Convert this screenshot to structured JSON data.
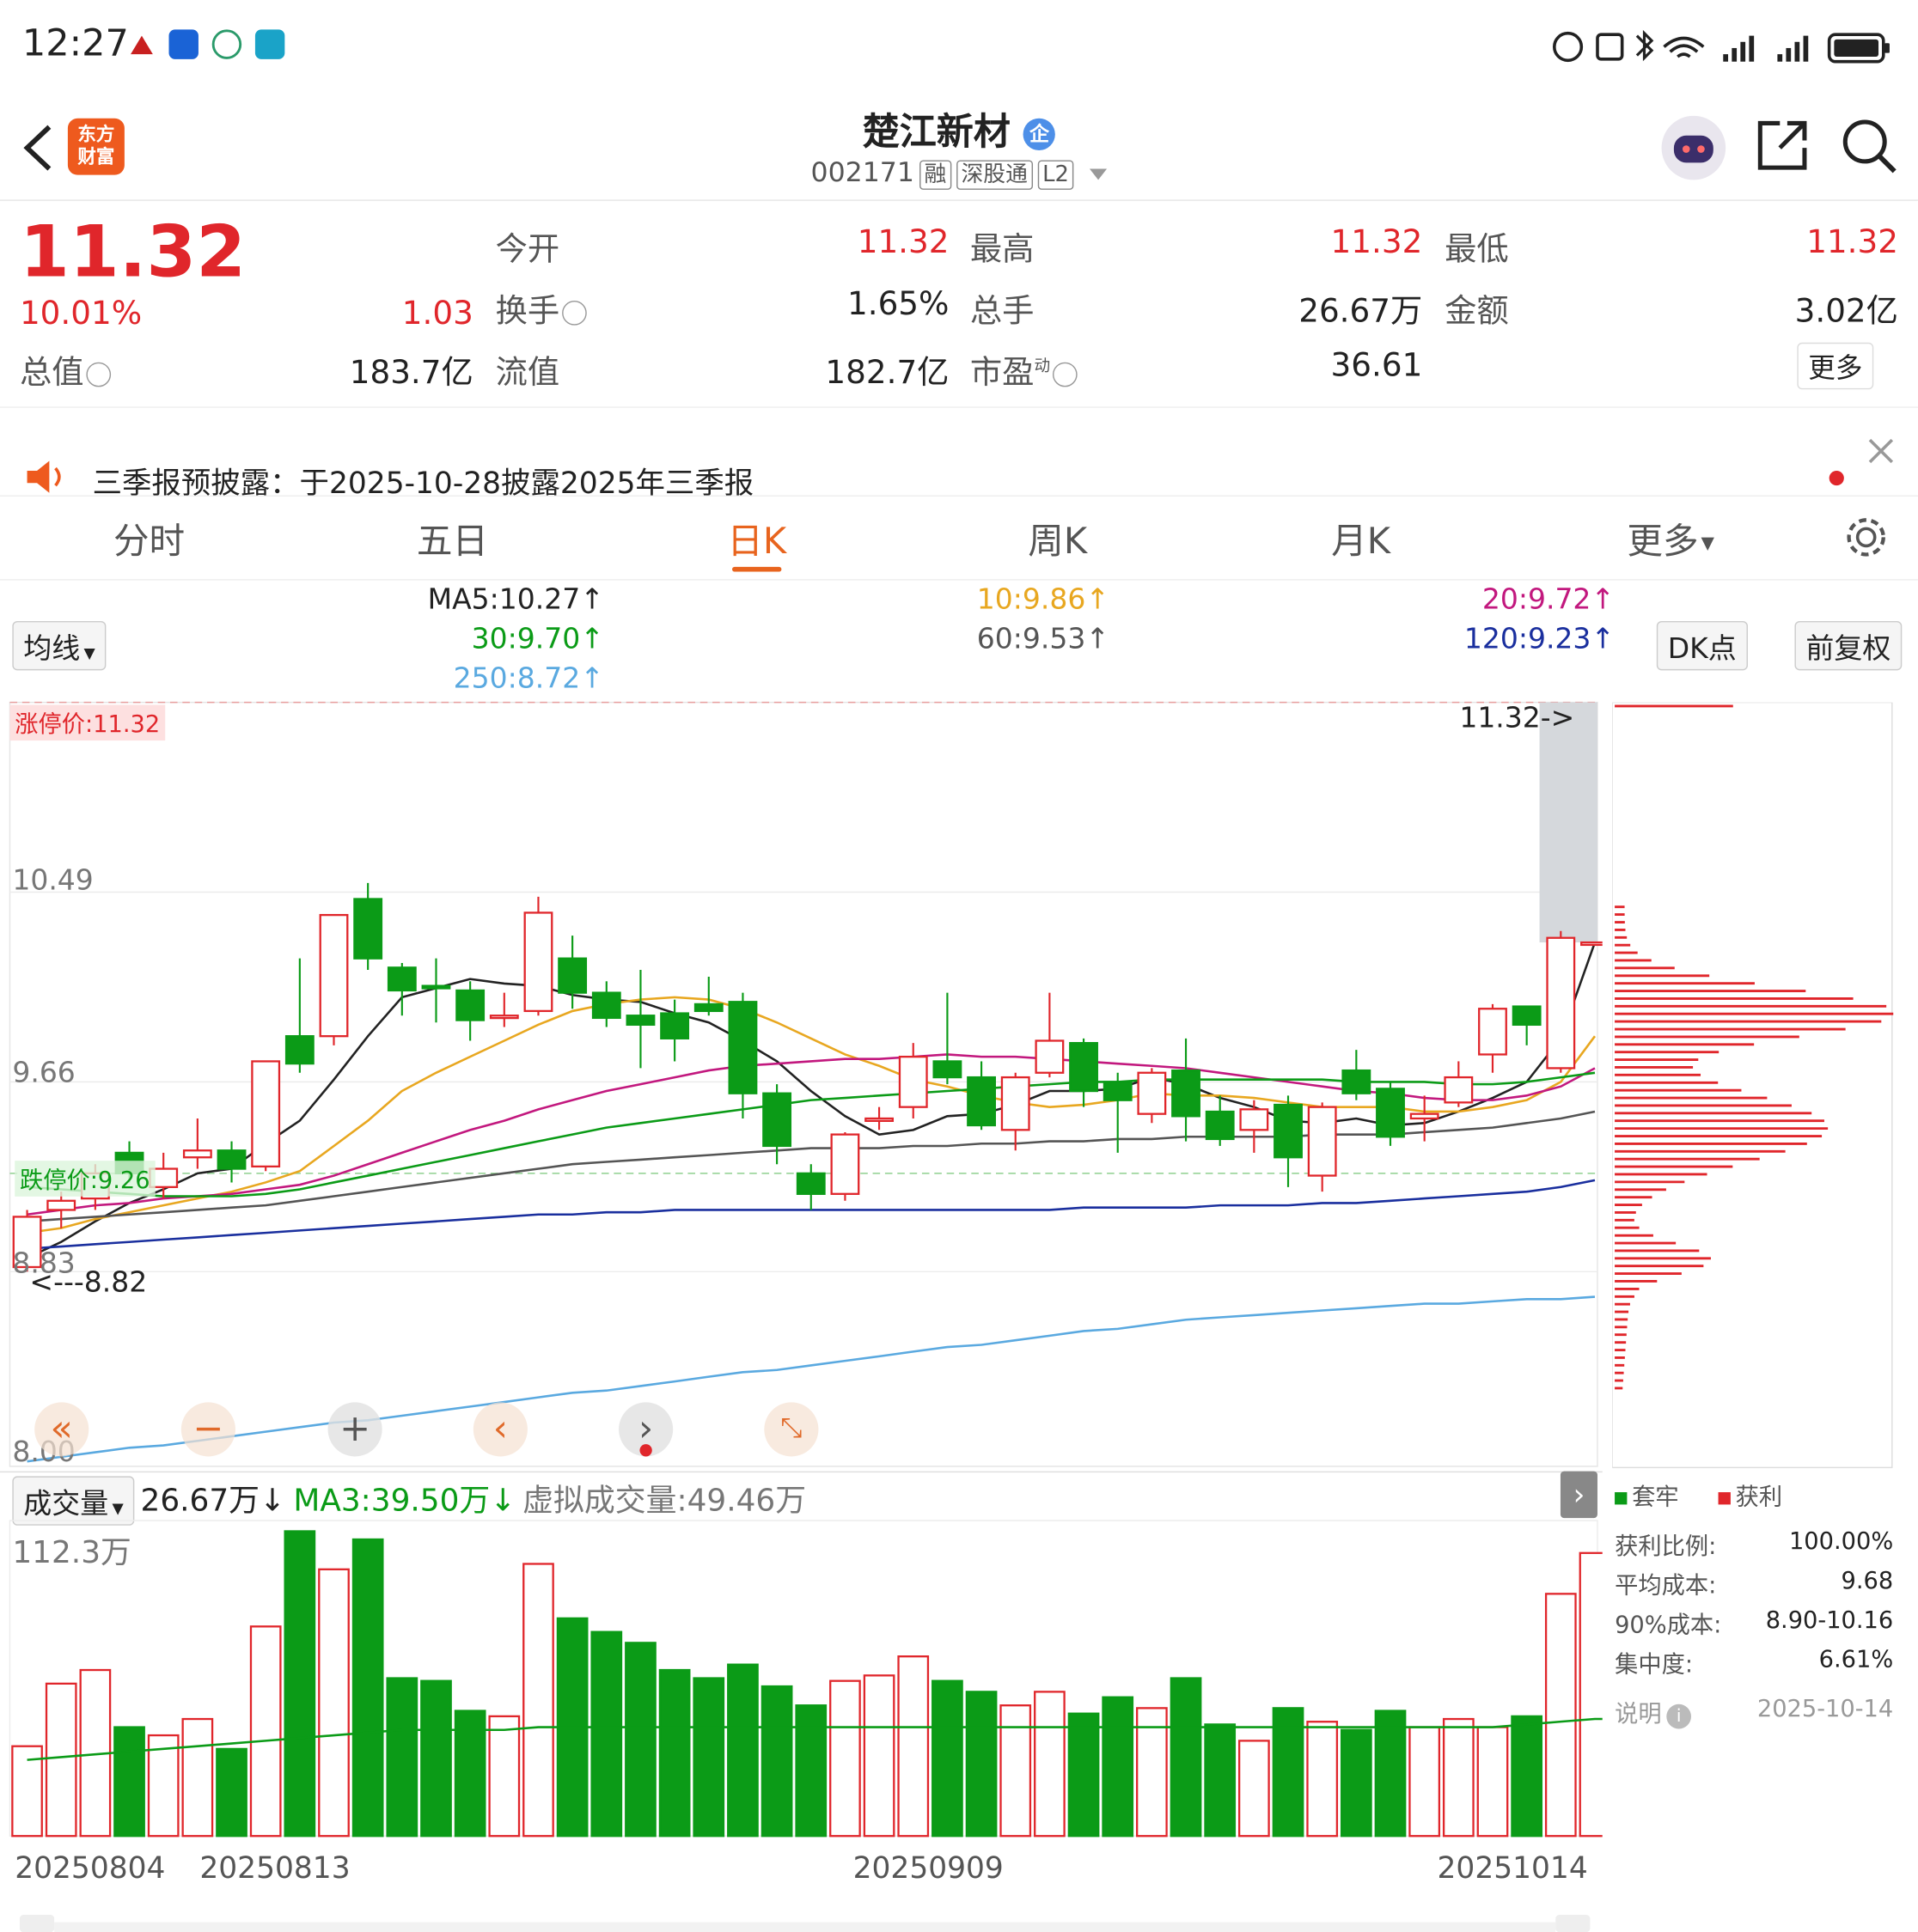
{
  "status_bar": {
    "time": "12:27"
  },
  "header": {
    "stock_name": "楚江新材",
    "badge": "企",
    "code": "002171",
    "tags": [
      "融",
      "深股通",
      "L2"
    ]
  },
  "quote": {
    "price": "11.32",
    "change_pct": "10.01%",
    "change": "1.03",
    "fields": [
      {
        "label": "今开",
        "value": "11.32",
        "red": true
      },
      {
        "label": "最高",
        "value": "11.32",
        "red": true
      },
      {
        "label": "最低",
        "value": "11.32",
        "red": true
      },
      {
        "label": "换手",
        "value": "1.65%",
        "red": false
      },
      {
        "label": "总手",
        "value": "26.67万",
        "red": false
      },
      {
        "label": "金额",
        "value": "3.02亿",
        "red": false
      },
      {
        "label": "总值",
        "value": "183.7亿",
        "red": false
      },
      {
        "label": "流值",
        "value": "182.7亿",
        "red": false
      },
      {
        "label": "市盈",
        "value": "36.61",
        "red": false
      }
    ],
    "pe_superscript": "动",
    "more_button": "更多"
  },
  "notice": {
    "text": "三季报预披露：于2025-10-28披露2025年三季报"
  },
  "tabs": [
    "分时",
    "五日",
    "日K",
    "周K",
    "月K",
    "更多"
  ],
  "active_tab": "日K",
  "ma_bar": {
    "selector": "均线",
    "dk_button": "DK点",
    "rights_button": "前复权",
    "items": [
      {
        "text": "MA5:10.27↑",
        "color": "#222222"
      },
      {
        "text": "10:9.86↑",
        "color": "#e8a720"
      },
      {
        "text": "20:9.72↑",
        "color": "#c2187e"
      },
      {
        "text": "30:9.70↑",
        "color": "#0b9b17"
      },
      {
        "text": "60:9.53↑",
        "color": "#555555"
      },
      {
        "text": "120:9.23↑",
        "color": "#1a2f9e"
      },
      {
        "text": "250:8.72↑",
        "color": "#5aa9e0"
      }
    ]
  },
  "main_chart": {
    "limit_up_label": "涨停价:11.32",
    "limit_down_label": "跌停价:9.26",
    "price_ticks": [
      "10.49",
      "9.66",
      "8.83",
      "8.00"
    ],
    "current_marker": "11.32->",
    "low_marker": "<---8.82"
  },
  "chart_data": {
    "type": "candlestick",
    "dates_shown": [
      "20250804",
      "20250813",
      "20250909",
      "20251014"
    ],
    "ylim": [
      8.0,
      11.32
    ],
    "candles": [
      {
        "o": 8.85,
        "c": 9.07,
        "h": 9.1,
        "l": 8.83
      },
      {
        "o": 9.1,
        "c": 9.14,
        "h": 9.18,
        "l": 9.02
      },
      {
        "o": 9.15,
        "c": 9.26,
        "h": 9.3,
        "l": 9.1
      },
      {
        "o": 9.35,
        "c": 9.26,
        "h": 9.4,
        "l": 9.22
      },
      {
        "o": 9.2,
        "c": 9.28,
        "h": 9.35,
        "l": 9.15
      },
      {
        "o": 9.33,
        "c": 9.36,
        "h": 9.5,
        "l": 9.28
      },
      {
        "o": 9.36,
        "c": 9.28,
        "h": 9.4,
        "l": 9.22
      },
      {
        "o": 9.29,
        "c": 9.75,
        "h": 9.75,
        "l": 9.27
      },
      {
        "o": 9.86,
        "c": 9.74,
        "h": 10.2,
        "l": 9.7
      },
      {
        "o": 9.86,
        "c": 10.39,
        "h": 10.39,
        "l": 9.82
      },
      {
        "o": 10.46,
        "c": 10.2,
        "h": 10.53,
        "l": 10.15
      },
      {
        "o": 10.16,
        "c": 10.06,
        "h": 10.18,
        "l": 9.95
      },
      {
        "o": 10.08,
        "c": 10.07,
        "h": 10.2,
        "l": 9.92
      },
      {
        "o": 10.06,
        "c": 9.93,
        "h": 10.1,
        "l": 9.84
      },
      {
        "o": 9.95,
        "c": 9.95,
        "h": 10.05,
        "l": 9.9
      },
      {
        "o": 9.97,
        "c": 10.4,
        "h": 10.47,
        "l": 9.95
      },
      {
        "o": 10.2,
        "c": 10.05,
        "h": 10.3,
        "l": 9.98
      },
      {
        "o": 10.05,
        "c": 9.94,
        "h": 10.1,
        "l": 9.9
      },
      {
        "o": 9.95,
        "c": 9.91,
        "h": 10.15,
        "l": 9.72
      },
      {
        "o": 9.96,
        "c": 9.85,
        "h": 10.02,
        "l": 9.75
      },
      {
        "o": 10.0,
        "c": 9.97,
        "h": 10.12,
        "l": 9.95
      },
      {
        "o": 10.01,
        "c": 9.61,
        "h": 10.05,
        "l": 9.5
      },
      {
        "o": 9.61,
        "c": 9.38,
        "h": 9.65,
        "l": 9.3
      },
      {
        "o": 9.26,
        "c": 9.17,
        "h": 9.3,
        "l": 9.1
      },
      {
        "o": 9.17,
        "c": 9.43,
        "h": 9.44,
        "l": 9.14
      },
      {
        "o": 9.5,
        "c": 9.5,
        "h": 9.55,
        "l": 9.45
      },
      {
        "o": 9.55,
        "c": 9.77,
        "h": 9.83,
        "l": 9.5
      },
      {
        "o": 9.75,
        "c": 9.68,
        "h": 10.05,
        "l": 9.65
      },
      {
        "o": 9.68,
        "c": 9.47,
        "h": 9.75,
        "l": 9.45
      },
      {
        "o": 9.45,
        "c": 9.68,
        "h": 9.7,
        "l": 9.36
      },
      {
        "o": 9.7,
        "c": 9.84,
        "h": 10.05,
        "l": 9.68
      },
      {
        "o": 9.83,
        "c": 9.62,
        "h": 9.85,
        "l": 9.55
      },
      {
        "o": 9.66,
        "c": 9.58,
        "h": 9.7,
        "l": 9.35
      },
      {
        "o": 9.52,
        "c": 9.7,
        "h": 9.72,
        "l": 9.48
      },
      {
        "o": 9.71,
        "c": 9.51,
        "h": 9.85,
        "l": 9.4
      },
      {
        "o": 9.53,
        "c": 9.41,
        "h": 9.6,
        "l": 9.38
      },
      {
        "o": 9.45,
        "c": 9.54,
        "h": 9.58,
        "l": 9.35
      },
      {
        "o": 9.56,
        "c": 9.33,
        "h": 9.6,
        "l": 9.2
      },
      {
        "o": 9.25,
        "c": 9.55,
        "h": 9.57,
        "l": 9.18
      },
      {
        "o": 9.71,
        "c": 9.61,
        "h": 9.8,
        "l": 9.58
      },
      {
        "o": 9.63,
        "c": 9.42,
        "h": 9.66,
        "l": 9.38
      },
      {
        "o": 9.5,
        "c": 9.52,
        "h": 9.6,
        "l": 9.4
      },
      {
        "o": 9.57,
        "c": 9.68,
        "h": 9.75,
        "l": 9.55
      },
      {
        "o": 9.78,
        "c": 9.98,
        "h": 10.0,
        "l": 9.7
      },
      {
        "o": 9.99,
        "c": 9.91,
        "h": 9.99,
        "l": 9.82
      },
      {
        "o": 9.72,
        "c": 10.29,
        "h": 10.32,
        "l": 9.7
      },
      {
        "o": 10.27,
        "c": 10.27,
        "h": 10.27,
        "l": 10.27
      }
    ],
    "ma_lines": [
      {
        "name": "MA5",
        "values": [
          8.89,
          8.96,
          9.05,
          9.13,
          9.19,
          9.26,
          9.28,
          9.39,
          9.49,
          9.67,
          9.86,
          10.03,
          10.07,
          10.11,
          10.09,
          10.08,
          10.04,
          10.02,
          10.01,
          9.96,
          9.92,
          9.84,
          9.75,
          9.62,
          9.51,
          9.43,
          9.45,
          9.51,
          9.52,
          9.56,
          9.62,
          9.62,
          9.63,
          9.68,
          9.65,
          9.59,
          9.55,
          9.49,
          9.48,
          9.5,
          9.47,
          9.48,
          9.53,
          9.59,
          9.66,
          9.85,
          10.27
        ]
      },
      {
        "name": "MA10",
        "values": [
          9.0,
          9.02,
          9.06,
          9.09,
          9.12,
          9.15,
          9.18,
          9.22,
          9.27,
          9.38,
          9.49,
          9.62,
          9.7,
          9.77,
          9.84,
          9.91,
          9.97,
          10.0,
          10.02,
          10.03,
          10.02,
          9.98,
          9.92,
          9.85,
          9.78,
          9.73,
          9.67,
          9.64,
          9.6,
          9.57,
          9.55,
          9.56,
          9.58,
          9.61,
          9.6,
          9.6,
          9.59,
          9.57,
          9.55,
          9.55,
          9.55,
          9.53,
          9.53,
          9.55,
          9.58,
          9.66,
          9.86
        ]
      },
      {
        "name": "MA20",
        "values": [
          9.08,
          9.1,
          9.12,
          9.13,
          9.15,
          9.16,
          9.17,
          9.19,
          9.21,
          9.25,
          9.3,
          9.35,
          9.4,
          9.45,
          9.49,
          9.54,
          9.58,
          9.62,
          9.65,
          9.68,
          9.71,
          9.73,
          9.74,
          9.75,
          9.76,
          9.76,
          9.77,
          9.78,
          9.77,
          9.77,
          9.76,
          9.75,
          9.74,
          9.73,
          9.72,
          9.7,
          9.68,
          9.66,
          9.64,
          9.62,
          9.61,
          9.59,
          9.58,
          9.58,
          9.6,
          9.64,
          9.72
        ]
      },
      {
        "name": "MA30",
        "values": [
          9.2,
          9.19,
          9.18,
          9.17,
          9.16,
          9.16,
          9.16,
          9.17,
          9.19,
          9.22,
          9.25,
          9.28,
          9.31,
          9.34,
          9.37,
          9.4,
          9.43,
          9.46,
          9.48,
          9.5,
          9.52,
          9.54,
          9.56,
          9.58,
          9.59,
          9.6,
          9.61,
          9.62,
          9.63,
          9.64,
          9.65,
          9.66,
          9.66,
          9.67,
          9.67,
          9.67,
          9.67,
          9.67,
          9.67,
          9.66,
          9.66,
          9.66,
          9.65,
          9.65,
          9.66,
          9.68,
          9.7
        ]
      },
      {
        "name": "MA60",
        "values": [
          9.05,
          9.06,
          9.07,
          9.08,
          9.09,
          9.1,
          9.11,
          9.12,
          9.14,
          9.16,
          9.18,
          9.2,
          9.22,
          9.24,
          9.26,
          9.28,
          9.3,
          9.31,
          9.32,
          9.33,
          9.34,
          9.35,
          9.36,
          9.37,
          9.37,
          9.37,
          9.38,
          9.38,
          9.39,
          9.39,
          9.4,
          9.4,
          9.41,
          9.41,
          9.42,
          9.42,
          9.42,
          9.42,
          9.43,
          9.43,
          9.43,
          9.44,
          9.45,
          9.46,
          9.48,
          9.5,
          9.53
        ]
      },
      {
        "name": "MA120",
        "values": [
          8.93,
          8.94,
          8.95,
          8.96,
          8.97,
          8.98,
          8.99,
          9.0,
          9.01,
          9.02,
          9.03,
          9.04,
          9.05,
          9.06,
          9.07,
          9.08,
          9.08,
          9.09,
          9.09,
          9.1,
          9.1,
          9.1,
          9.1,
          9.1,
          9.1,
          9.1,
          9.1,
          9.1,
          9.1,
          9.1,
          9.1,
          9.11,
          9.11,
          9.11,
          9.11,
          9.12,
          9.12,
          9.12,
          9.13,
          9.13,
          9.14,
          9.15,
          9.16,
          9.17,
          9.18,
          9.2,
          9.23
        ]
      },
      {
        "name": "MA250",
        "values": [
          8.0,
          8.02,
          8.04,
          8.06,
          8.07,
          8.09,
          8.11,
          8.13,
          8.15,
          8.17,
          8.18,
          8.2,
          8.22,
          8.24,
          8.26,
          8.28,
          8.3,
          8.31,
          8.33,
          8.35,
          8.37,
          8.39,
          8.4,
          8.42,
          8.44,
          8.46,
          8.48,
          8.5,
          8.51,
          8.53,
          8.55,
          8.57,
          8.58,
          8.6,
          8.62,
          8.63,
          8.64,
          8.65,
          8.66,
          8.67,
          8.68,
          8.69,
          8.69,
          8.7,
          8.71,
          8.71,
          8.72
        ]
      }
    ],
    "volume": {
      "max_label": "112.3万",
      "values": [
        33,
        56,
        61,
        40,
        37,
        43,
        32,
        77,
        112,
        98,
        109,
        58,
        57,
        46,
        44,
        100,
        80,
        75,
        71,
        61,
        58,
        63,
        55,
        48,
        57,
        59,
        66,
        57,
        53,
        48,
        53,
        45,
        51,
        47,
        58,
        41,
        35,
        47,
        42,
        39,
        46,
        40,
        43,
        40,
        44,
        89,
        104,
        26.67
      ],
      "ma3": [
        28,
        29,
        30,
        31,
        32,
        33,
        34,
        35,
        36,
        37,
        38,
        39,
        39,
        39,
        39,
        40,
        40,
        40,
        40,
        40,
        40,
        40,
        40,
        40,
        40,
        40,
        40,
        40,
        40,
        40,
        40,
        40,
        40,
        40,
        40,
        40,
        40,
        40,
        40,
        40,
        40,
        40,
        40,
        40,
        41,
        42,
        43,
        43
      ]
    }
  },
  "volume_bar": {
    "selector": "成交量",
    "vol_text": "26.67万↓",
    "ma3_text": "MA3:39.50万↓",
    "virtual_text": "虚拟成交量:49.46万"
  },
  "chip_panel": {
    "legend_trapped": "套牢",
    "legend_profit": "获利",
    "rows": [
      {
        "label": "获利比例:",
        "value": "100.00%"
      },
      {
        "label": "平均成本:",
        "value": "9.68"
      },
      {
        "label": "90%成本:",
        "value": "8.90-10.16"
      },
      {
        "label": "集中度:",
        "value": "6.61%"
      }
    ],
    "note_label": "说明",
    "date": "2025-10-14"
  }
}
